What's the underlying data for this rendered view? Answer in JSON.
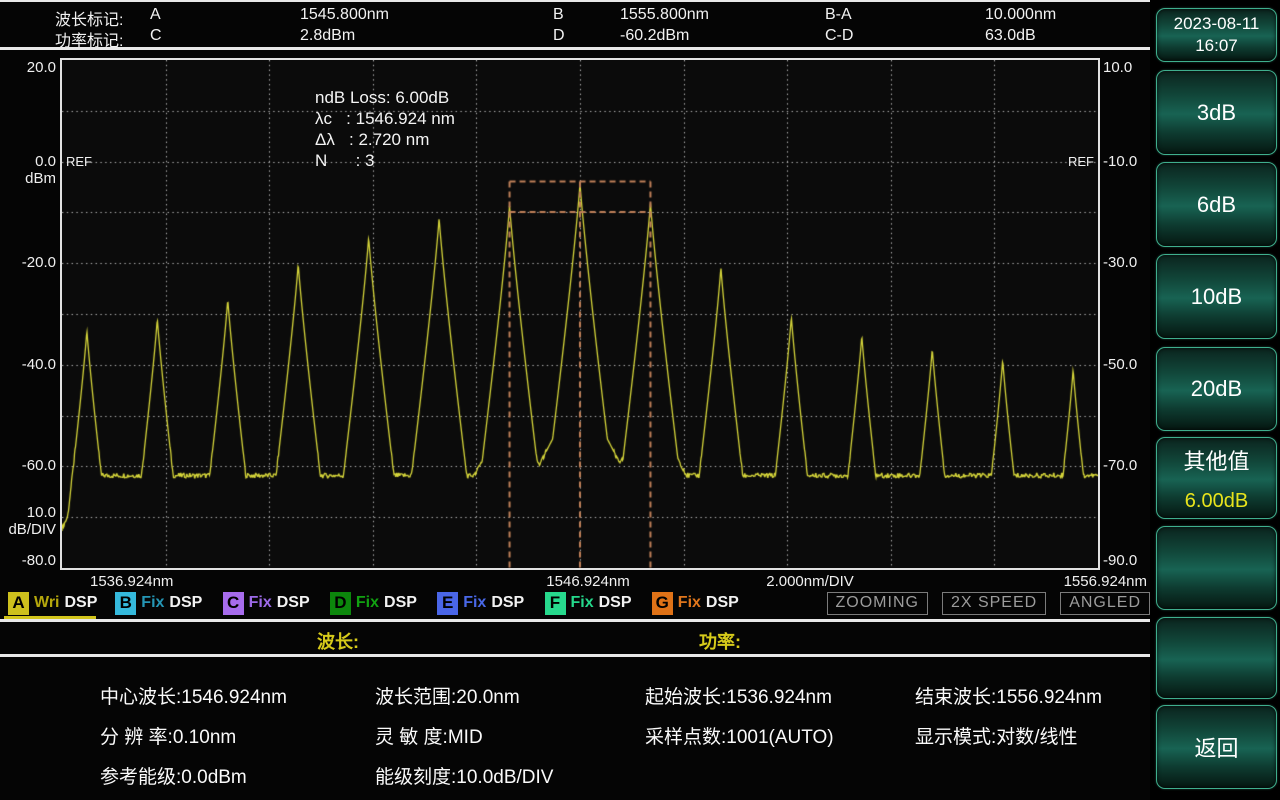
{
  "header": {
    "rows": [
      {
        "label": "波长标记:",
        "m1": "A",
        "v1": "1545.800nm",
        "m2": "B",
        "v2": "1555.800nm",
        "m3": "B-A",
        "v3": "10.000nm"
      },
      {
        "label": "功率标记:",
        "m1": "C",
        "v1": "2.8dBm",
        "m2": "D",
        "v2": "-60.2dBm",
        "m3": "C-D",
        "v3": "63.0dB"
      }
    ]
  },
  "chart_data": {
    "type": "line",
    "title": "Optical spectrum trace",
    "x_start_nm": 1536.924,
    "x_stop_nm": 1556.924,
    "x_per_div_nm": 2.0,
    "y_left_top_dbm": 20.0,
    "y_left_bottom_dbm": -80.0,
    "db_per_div": 10.0,
    "ref_level_dbm": 0.0,
    "noise_floor_dbm": -61.8,
    "trace_color": "#d6d63a",
    "grid_color": "#d2d2d2",
    "ref_label": "REF",
    "left_ticks": [
      {
        "v": 20,
        "t": "20.0"
      },
      {
        "v": 0,
        "t": "0.0",
        "sub": "dBm"
      },
      {
        "v": -20,
        "t": "-20.0"
      },
      {
        "v": -40,
        "t": "-40.0"
      },
      {
        "v": -60,
        "t": "-60.0"
      },
      {
        "v": -80,
        "t": "-80.0"
      }
    ],
    "scale_label": {
      "t": "10.0",
      "sub": "dB/DIV"
    },
    "right_ticks": [
      {
        "v": 20,
        "t": "10.0"
      },
      {
        "v": 0,
        "t": "-10.0"
      },
      {
        "v": -20,
        "t": "-30.0"
      },
      {
        "v": -40,
        "t": "-50.0"
      },
      {
        "v": -60,
        "t": "-70.0"
      },
      {
        "v": -80,
        "t": "-90.0"
      }
    ],
    "x_labels": {
      "start": "1536.924nm",
      "center": "1546.924nm",
      "div": "2.000nm/DIV",
      "stop": "1556.924nm"
    },
    "annotation": [
      "ndB Loss: 6.00dB",
      "λc   : 1546.924 nm",
      "Δλ   : 2.720 nm",
      "N      : 3"
    ],
    "overlay": {
      "color": "#c08058",
      "left_nm": 1545.564,
      "center_nm": 1546.924,
      "right_nm": 1548.284,
      "top_dbm": -3.9,
      "ndb_dbm": -9.9
    },
    "peaks": [
      {
        "nm": 1537.404,
        "dbm": -33.1
      },
      {
        "nm": 1538.764,
        "dbm": -30.8
      },
      {
        "nm": 1540.124,
        "dbm": -27.0
      },
      {
        "nm": 1541.484,
        "dbm": -20.0
      },
      {
        "nm": 1542.844,
        "dbm": -14.8
      },
      {
        "nm": 1544.204,
        "dbm": -11.0
      },
      {
        "nm": 1545.564,
        "dbm": -8.5
      },
      {
        "nm": 1546.924,
        "dbm": -4.2
      },
      {
        "nm": 1548.284,
        "dbm": -8.0
      },
      {
        "nm": 1549.644,
        "dbm": -20.7
      },
      {
        "nm": 1551.004,
        "dbm": -30.4
      },
      {
        "nm": 1552.364,
        "dbm": -34.1
      },
      {
        "nm": 1553.724,
        "dbm": -36.7
      },
      {
        "nm": 1555.084,
        "dbm": -38.9
      },
      {
        "nm": 1556.444,
        "dbm": -40.8
      }
    ]
  },
  "legend": {
    "traces": [
      {
        "letter": "A",
        "mode": "Wri",
        "suffix": "DSP",
        "box_color": "#cdc01d",
        "mode_color": "#b5a70c",
        "active": true
      },
      {
        "letter": "B",
        "mode": "Fix",
        "suffix": "DSP",
        "box_color": "#35b9dc",
        "mode_color": "#2596b5",
        "active": false
      },
      {
        "letter": "C",
        "mode": "Fix",
        "suffix": "DSP",
        "box_color": "#a76ced",
        "mode_color": "#9d6ae8",
        "active": false
      },
      {
        "letter": "D",
        "mode": "Fix",
        "suffix": "DSP",
        "box_color": "#0c870c",
        "mode_color": "#11a011",
        "active": false
      },
      {
        "letter": "E",
        "mode": "Fix",
        "suffix": "DSP",
        "box_color": "#4a66e8",
        "mode_color": "#4968e8",
        "active": false
      },
      {
        "letter": "F",
        "mode": "Fix",
        "suffix": "DSP",
        "box_color": "#27d98d",
        "mode_color": "#25d88b",
        "active": false
      },
      {
        "letter": "G",
        "mode": "Fix",
        "suffix": "DSP",
        "box_color": "#df7217",
        "mode_color": "#e0761c",
        "active": false
      }
    ],
    "badges": [
      "ZOOMING",
      "2X SPEED",
      "ANGLED"
    ]
  },
  "section_labels": {
    "wavelength": "波长:",
    "power": "功率:"
  },
  "info": {
    "rows": [
      [
        "中心波长:1546.924nm",
        "波长范围:20.0nm",
        "起始波长:1536.924nm",
        "结束波长:1556.924nm"
      ],
      [
        "分 辨 率:0.10nm",
        "灵 敏 度:MID",
        "采样点数:1001(AUTO)",
        "显示模式:对数/线性"
      ],
      [
        "参考能级:0.0dBm",
        "能级刻度:10.0dB/DIV",
        "",
        ""
      ]
    ]
  },
  "sidebar": {
    "value_color": "#e8e41c",
    "buttons": [
      {
        "name": "datetime",
        "lines": [
          "2023-08-11",
          "16:07"
        ],
        "small": true
      },
      {
        "name": "3db",
        "lines": [
          "3dB"
        ]
      },
      {
        "name": "6db",
        "lines": [
          "6dB"
        ]
      },
      {
        "name": "10db",
        "lines": [
          "10dB"
        ]
      },
      {
        "name": "20db",
        "lines": [
          "20dB"
        ]
      },
      {
        "name": "other-value",
        "lines": [
          "其他值",
          "6.00dB"
        ],
        "value_line": 1
      },
      {
        "name": "blank-1",
        "lines": []
      },
      {
        "name": "blank-2",
        "lines": []
      },
      {
        "name": "back",
        "lines": [
          "返回"
        ]
      }
    ]
  }
}
